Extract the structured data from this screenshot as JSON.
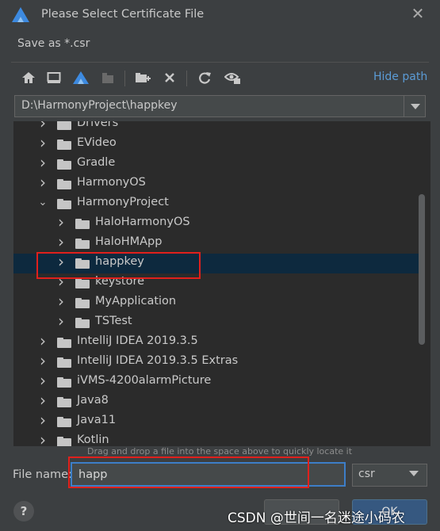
{
  "dialog": {
    "title": "Please Select Certificate File",
    "subtitle": "Save as *.csr",
    "close_icon": "close-icon"
  },
  "toolbar": {
    "icons": [
      "home-icon",
      "desktop-icon",
      "project-icon",
      "module-icon",
      "new-folder-icon",
      "delete-icon",
      "refresh-icon",
      "show-hidden-icon"
    ],
    "hide_path_label": "Hide path"
  },
  "path": {
    "value": "D:\\HarmonyProject\\happkey"
  },
  "tree": {
    "items": [
      {
        "label": "Drivers",
        "level": 1,
        "expanded": false
      },
      {
        "label": "EVideo",
        "level": 1,
        "expanded": false
      },
      {
        "label": "Gradle",
        "level": 1,
        "expanded": false
      },
      {
        "label": "HarmonyOS",
        "level": 1,
        "expanded": false
      },
      {
        "label": "HarmonyProject",
        "level": 1,
        "expanded": true
      },
      {
        "label": "HaloHarmonyOS",
        "level": 2,
        "expanded": false
      },
      {
        "label": "HaloHMApp",
        "level": 2,
        "expanded": false
      },
      {
        "label": "happkey",
        "level": 2,
        "expanded": false,
        "selected": true
      },
      {
        "label": "keystore",
        "level": 2,
        "expanded": false
      },
      {
        "label": "MyApplication",
        "level": 2,
        "expanded": false
      },
      {
        "label": "TSTest",
        "level": 2,
        "expanded": false
      },
      {
        "label": "IntelliJ IDEA 2019.3.5",
        "level": 1,
        "expanded": false
      },
      {
        "label": "IntelliJ IDEA 2019.3.5 Extras",
        "level": 1,
        "expanded": false
      },
      {
        "label": "iVMS-4200alarmPicture",
        "level": 1,
        "expanded": false
      },
      {
        "label": "Java8",
        "level": 1,
        "expanded": false
      },
      {
        "label": "Java11",
        "level": 1,
        "expanded": false
      },
      {
        "label": "Kotlin",
        "level": 1,
        "expanded": false
      }
    ],
    "drag_hint": "Drag and drop a file into the space above to quickly locate it"
  },
  "file_name": {
    "label": "File name:",
    "value": "happ"
  },
  "extension": {
    "selected": "csr"
  },
  "buttons": {
    "help_label": "?",
    "ok_label": "OK"
  },
  "watermark": {
    "text": "CSDN @世间一名迷途小码农"
  },
  "colors": {
    "background": "#3c3f41",
    "tree_background": "#2b2b2b",
    "selection": "#0d293e",
    "link": "#5b9bd5",
    "highlight": "#e0201c",
    "focus": "#3d7ec8"
  }
}
